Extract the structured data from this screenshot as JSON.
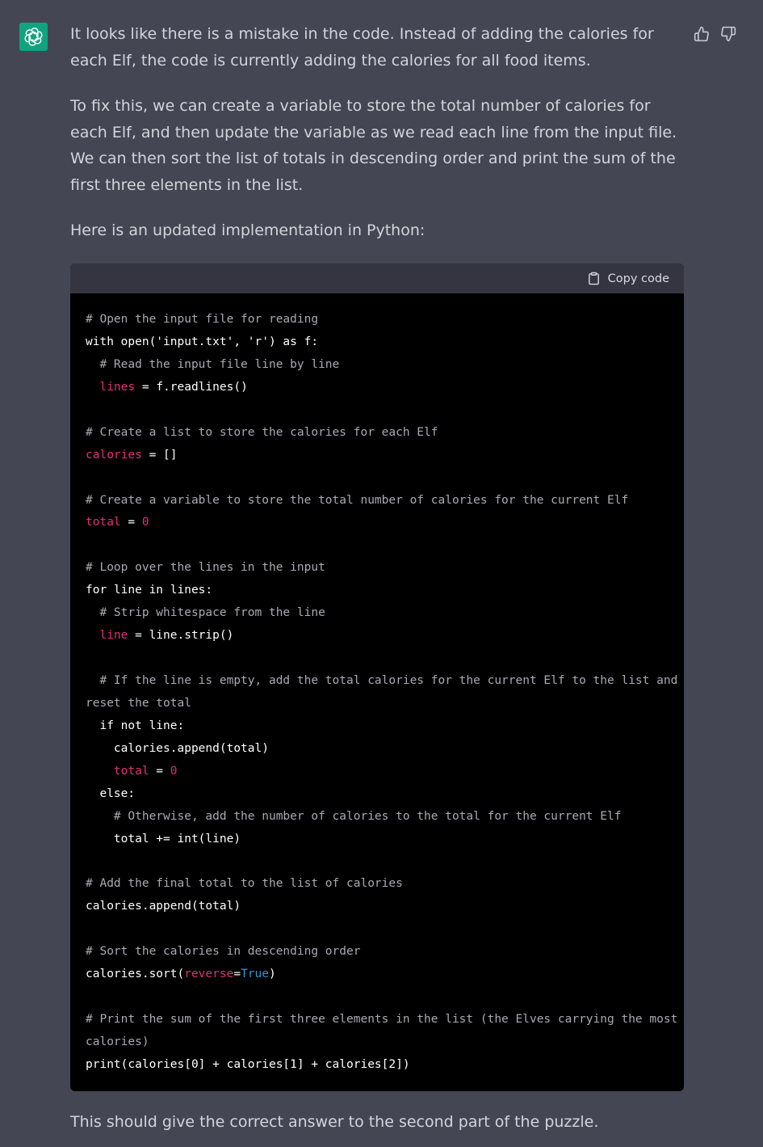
{
  "colors": {
    "background": "#444654",
    "avatar": "#10a37f",
    "code_bg": "#000000",
    "code_header_bg": "#343541",
    "comment": "#a9a9b3",
    "variable": "#df3079",
    "keyword": "#2e95d3"
  },
  "avatar": {
    "icon": "openai-logo-icon"
  },
  "feedback": {
    "up_icon": "thumbs-up-icon",
    "down_icon": "thumbs-down-icon"
  },
  "message": {
    "p1": "It looks like there is a mistake in the code. Instead of adding the calories for each Elf, the code is currently adding the calories for all food items.",
    "p2": "To fix this, we can create a variable to store the total number of calories for each Elf, and then update the variable as we read each line from the input file. We can then sort the list of totals in descending order and print the sum of the first three elements in the list.",
    "p3": "Here is an updated implementation in Python:",
    "p4": "This should give the correct answer to the second part of the puzzle."
  },
  "code": {
    "copy_label": "Copy code",
    "copy_icon": "clipboard-icon",
    "lines": [
      [
        {
          "t": "# Open the input file for reading",
          "c": "c-com"
        }
      ],
      [
        {
          "t": "with open('input.txt', 'r') as f:",
          "c": "c-txt"
        }
      ],
      [
        {
          "t": "  # Read the input file line by line",
          "c": "c-com"
        }
      ],
      [
        {
          "t": "  ",
          "c": "c-txt"
        },
        {
          "t": "lines",
          "c": "c-var"
        },
        {
          "t": " = f.readlines()",
          "c": "c-txt"
        }
      ],
      [],
      [
        {
          "t": "# Create a list to store the calories for each Elf",
          "c": "c-com"
        }
      ],
      [
        {
          "t": "calories",
          "c": "c-var"
        },
        {
          "t": " = []",
          "c": "c-txt"
        }
      ],
      [],
      [
        {
          "t": "# Create a variable to store the total number of calories for the current Elf",
          "c": "c-com"
        }
      ],
      [
        {
          "t": "total",
          "c": "c-var"
        },
        {
          "t": " = ",
          "c": "c-txt"
        },
        {
          "t": "0",
          "c": "c-num"
        }
      ],
      [],
      [
        {
          "t": "# Loop over the lines in the input",
          "c": "c-com"
        }
      ],
      [
        {
          "t": "for line in lines:",
          "c": "c-txt"
        }
      ],
      [
        {
          "t": "  # Strip whitespace from the line",
          "c": "c-com"
        }
      ],
      [
        {
          "t": "  ",
          "c": "c-txt"
        },
        {
          "t": "line",
          "c": "c-var"
        },
        {
          "t": " = line.strip()",
          "c": "c-txt"
        }
      ],
      [],
      [
        {
          "t": "  # If the line is empty, add the total calories for the current Elf to the list and",
          "c": "c-com"
        }
      ],
      [
        {
          "t": "reset the total",
          "c": "c-com"
        }
      ],
      [
        {
          "t": "  if not line:",
          "c": "c-txt"
        }
      ],
      [
        {
          "t": "    calories.append(total)",
          "c": "c-txt"
        }
      ],
      [
        {
          "t": "    ",
          "c": "c-txt"
        },
        {
          "t": "total",
          "c": "c-var"
        },
        {
          "t": " = ",
          "c": "c-txt"
        },
        {
          "t": "0",
          "c": "c-num"
        }
      ],
      [
        {
          "t": "  else:",
          "c": "c-txt"
        }
      ],
      [
        {
          "t": "    # Otherwise, add the number of calories to the total for the current Elf",
          "c": "c-com"
        }
      ],
      [
        {
          "t": "    total += int(line)",
          "c": "c-txt"
        }
      ],
      [],
      [
        {
          "t": "# Add the final total to the list of calories",
          "c": "c-com"
        }
      ],
      [
        {
          "t": "calories.append(total)",
          "c": "c-txt"
        }
      ],
      [],
      [
        {
          "t": "# Sort the calories in descending order",
          "c": "c-com"
        }
      ],
      [
        {
          "t": "calories.sort(",
          "c": "c-txt"
        },
        {
          "t": "reverse",
          "c": "c-var"
        },
        {
          "t": "=",
          "c": "c-txt"
        },
        {
          "t": "True",
          "c": "c-kw"
        },
        {
          "t": ")",
          "c": "c-txt"
        }
      ],
      [],
      [
        {
          "t": "# Print the sum of the first three elements in the list (the Elves carrying the most",
          "c": "c-com"
        }
      ],
      [
        {
          "t": "calories)",
          "c": "c-com"
        }
      ],
      [
        {
          "t": "print(calories[0] + calories[1] + calories[2])",
          "c": "c-txt"
        }
      ]
    ]
  }
}
